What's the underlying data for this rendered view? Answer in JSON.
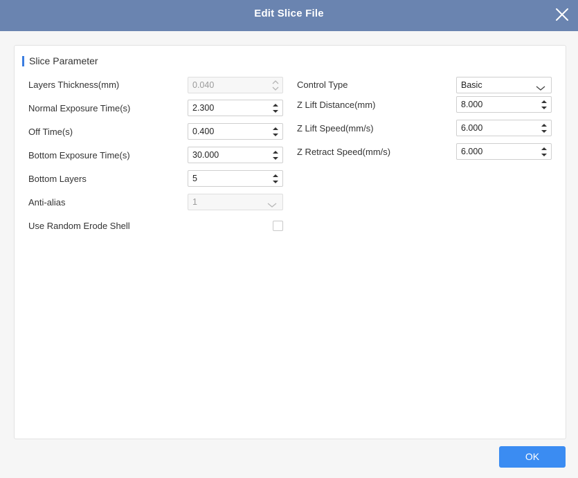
{
  "dialog": {
    "title": "Edit Slice File",
    "ok_label": "OK"
  },
  "section": {
    "title": "Slice Parameter"
  },
  "left": {
    "layers_thickness": {
      "label": "Layers Thickness(mm)",
      "value": "0.040"
    },
    "normal_exposure": {
      "label": "Normal Exposure Time(s)",
      "value": "2.300"
    },
    "off_time": {
      "label": "Off Time(s)",
      "value": "0.400"
    },
    "bottom_exposure": {
      "label": "Bottom Exposure Time(s)",
      "value": "30.000"
    },
    "bottom_layers": {
      "label": "Bottom Layers",
      "value": "5"
    },
    "anti_alias": {
      "label": "Anti-alias",
      "value": "1"
    },
    "random_erode": {
      "label": "Use Random Erode Shell"
    }
  },
  "right": {
    "control_type": {
      "label": "Control Type",
      "value": "Basic"
    },
    "z_lift_distance": {
      "label": "Z Lift Distance(mm)",
      "value": "8.000"
    },
    "z_lift_speed": {
      "label": "Z Lift Speed(mm/s)",
      "value": "6.000"
    },
    "z_retract_speed": {
      "label": "Z Retract Speed(mm/s)",
      "value": "6.000"
    }
  },
  "colors": {
    "titlebar": "#6a84b0",
    "accent": "#3b8cf2",
    "section_marker": "#3b7de0"
  }
}
